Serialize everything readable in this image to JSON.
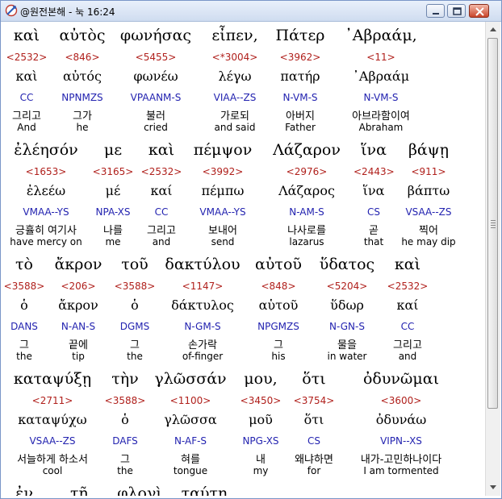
{
  "window": {
    "title": "@원전본해 - 눅 16:24"
  },
  "lines": [
    {
      "words": [
        {
          "greek": "καὶ",
          "strong": "<2532>",
          "lemma": "καὶ",
          "parsing": "CC",
          "korean": "그리고",
          "english": "And"
        },
        {
          "greek": "αὐτὸς",
          "strong": "<846>",
          "lemma": "αὐτός",
          "parsing": "NPNMZS",
          "korean": "그가",
          "english": "he"
        },
        {
          "greek": "φωνήσας",
          "strong": "<5455>",
          "lemma": "φωνέω",
          "parsing": "VPAANM-S",
          "korean": "불러",
          "english": "cried"
        },
        {
          "greek": "εἶπεν,",
          "strong": "<*3004>",
          "lemma": "λέγω",
          "parsing": "VIAA--ZS",
          "korean": "가로되",
          "english": "and said"
        },
        {
          "greek": "Πάτερ",
          "strong": "<3962>",
          "lemma": "πατήρ",
          "parsing": "N-VM-S",
          "korean": "아버지",
          "english": "Father"
        },
        {
          "greek": "᾿Αβραάμ,",
          "strong": "<11>",
          "lemma": "᾿Αβραάμ",
          "parsing": "N-VM-S",
          "korean": "아브라함이여",
          "english": "Abraham"
        }
      ]
    },
    {
      "words": [
        {
          "greek": "ἐλέησόν",
          "strong": "<1653>",
          "lemma": "ἐλεέω",
          "parsing": "VMAA--YS",
          "korean": "긍휼히 여기사",
          "english": "have mercy on"
        },
        {
          "greek": "με",
          "strong": "<3165>",
          "lemma": "μέ",
          "parsing": "NPA-XS",
          "korean": "나를",
          "english": "me"
        },
        {
          "greek": "καὶ",
          "strong": "<2532>",
          "lemma": "καί",
          "parsing": "CC",
          "korean": "그리고",
          "english": "and"
        },
        {
          "greek": "πέμψον",
          "strong": "<3992>",
          "lemma": "πέμπω",
          "parsing": "VMAA--YS",
          "korean": "보내어",
          "english": "send"
        },
        {
          "greek": "Λάζαρον",
          "strong": "<2976>",
          "lemma": "Λάζαρος",
          "parsing": "N-AM-S",
          "korean": "나사로를",
          "english": "lazarus"
        },
        {
          "greek": "ἵνα",
          "strong": "<2443>",
          "lemma": "ἵνα",
          "parsing": "CS",
          "korean": "곧",
          "english": "that"
        },
        {
          "greek": "βάψῃ",
          "strong": "<911>",
          "lemma": "βάπτω",
          "parsing": "VSAA--ZS",
          "korean": "찍어",
          "english": "he may dip"
        }
      ]
    },
    {
      "words": [
        {
          "greek": "τὸ",
          "strong": "<3588>",
          "lemma": "ὁ",
          "parsing": "DANS",
          "korean": "그",
          "english": "the"
        },
        {
          "greek": "ἄκρον",
          "strong": "<206>",
          "lemma": "ἄκρον",
          "parsing": "N-AN-S",
          "korean": "끝에",
          "english": "tip"
        },
        {
          "greek": "τοῦ",
          "strong": "<3588>",
          "lemma": "ὁ",
          "parsing": "DGMS",
          "korean": "그",
          "english": "the"
        },
        {
          "greek": "δακτύλου",
          "strong": "<1147>",
          "lemma": "δάκτυλος",
          "parsing": "N-GM-S",
          "korean": "손가락",
          "english": "of-finger"
        },
        {
          "greek": "αὐτοῦ",
          "strong": "<848>",
          "lemma": "αὑτοῦ",
          "parsing": "NPGMZS",
          "korean": "그",
          "english": "his"
        },
        {
          "greek": "ὕδατος",
          "strong": "<5204>",
          "lemma": "ὕδωρ",
          "parsing": "N-GN-S",
          "korean": "물을",
          "english": "in water"
        },
        {
          "greek": "καὶ",
          "strong": "<2532>",
          "lemma": "καί",
          "parsing": "CC",
          "korean": "그리고",
          "english": "and"
        }
      ]
    },
    {
      "words": [
        {
          "greek": "καταψύξῃ",
          "strong": "<2711>",
          "lemma": "καταψύχω",
          "parsing": "VSAA--ZS",
          "korean": "서늘하게 하소서",
          "english": "cool"
        },
        {
          "greek": "τὴν",
          "strong": "<3588>",
          "lemma": "ὁ",
          "parsing": "DAFS",
          "korean": "그",
          "english": "the"
        },
        {
          "greek": "γλῶσσάν",
          "strong": "<1100>",
          "lemma": "γλῶσσα",
          "parsing": "N-AF-S",
          "korean": "혀를",
          "english": "tongue"
        },
        {
          "greek": "μου,",
          "strong": "<3450>",
          "lemma": "μοῦ",
          "parsing": "NPG-XS",
          "korean": "내",
          "english": "my"
        },
        {
          "greek": "ὅτι",
          "strong": "<3754>",
          "lemma": "ὅτι",
          "parsing": "CS",
          "korean": "왜냐하면",
          "english": "for"
        },
        {
          "greek": "ὀδυνῶμαι",
          "strong": "<3600>",
          "lemma": "ὀδυνάω",
          "parsing": "VIPN--XS",
          "korean": "내가-고민하나이다",
          "english": "I am tormented"
        }
      ]
    },
    {
      "words": [
        {
          "greek": "ἐν"
        },
        {
          "greek": "τῇ"
        },
        {
          "greek": "φλογὶ"
        },
        {
          "greek": "ταύτῃ."
        }
      ]
    }
  ],
  "colors": {
    "greek": "#000000",
    "strong": "#b0201c",
    "parsing": "#2323b0",
    "gloss": "#000000"
  }
}
